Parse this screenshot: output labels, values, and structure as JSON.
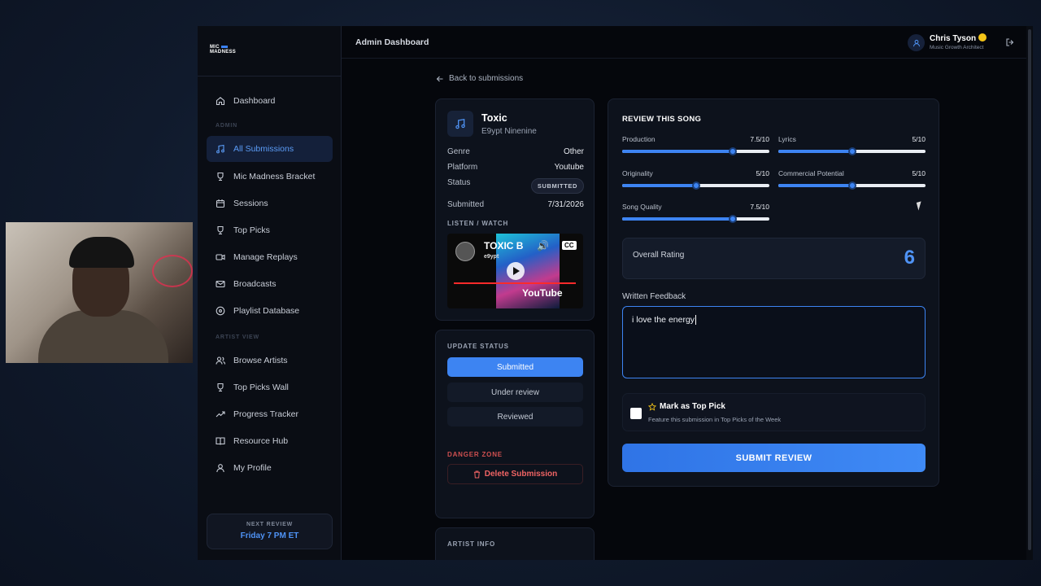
{
  "app": {
    "logo_line1": "MIC",
    "logo_line2": "MADNESS",
    "page_title": "Admin Dashboard"
  },
  "user": {
    "name": "Chris Tyson",
    "role": "Music Growth Architect"
  },
  "sidebar": {
    "items_top": [
      {
        "label": "Dashboard",
        "icon": "home-icon"
      }
    ],
    "admin_label": "ADMIN",
    "admin_items": [
      {
        "label": "All Submissions",
        "icon": "music-note-icon",
        "active": true
      },
      {
        "label": "Mic Madness Bracket",
        "icon": "trophy-icon"
      },
      {
        "label": "Sessions",
        "icon": "calendar-icon"
      },
      {
        "label": "Top Picks",
        "icon": "trophy-icon"
      },
      {
        "label": "Manage Replays",
        "icon": "video-icon"
      },
      {
        "label": "Broadcasts",
        "icon": "mail-icon"
      },
      {
        "label": "Playlist Database",
        "icon": "disc-icon"
      }
    ],
    "artist_label": "ARTIST VIEW",
    "artist_items": [
      {
        "label": "Browse Artists",
        "icon": "users-icon"
      },
      {
        "label": "Top Picks Wall",
        "icon": "trophy-icon"
      },
      {
        "label": "Progress Tracker",
        "icon": "trending-up-icon"
      },
      {
        "label": "Resource Hub",
        "icon": "book-icon"
      },
      {
        "label": "My Profile",
        "icon": "user-icon"
      }
    ],
    "next_review_label": "NEXT REVIEW",
    "next_review_value": "Friday 7 PM ET"
  },
  "back_link": "Back to submissions",
  "song": {
    "title": "Toxic",
    "artist": "E9ypt Ninenine",
    "fields": [
      {
        "label": "Genre",
        "value": "Other"
      },
      {
        "label": "Platform",
        "value": "Youtube"
      },
      {
        "label": "Status",
        "value": "SUBMITTED"
      },
      {
        "label": "Submitted",
        "value": "7/31/2026"
      }
    ],
    "listen_label": "LISTEN / WATCH",
    "video_title": "TOXIC B",
    "video_channel": "e9ypt",
    "video_brand": "YouTube",
    "video_cc": "CC"
  },
  "status_panel": {
    "label": "UPDATE STATUS",
    "options": [
      "Submitted",
      "Under review",
      "Reviewed"
    ],
    "selected": "Submitted",
    "danger_label": "DANGER ZONE",
    "delete_label": "Delete Submission"
  },
  "artist_info_label": "ARTIST INFO",
  "review": {
    "heading": "REVIEW THIS SONG",
    "criteria": [
      {
        "label": "Production",
        "value_text": "7.5/10",
        "value": 7.5,
        "max": 10
      },
      {
        "label": "Lyrics",
        "value_text": "5/10",
        "value": 5,
        "max": 10
      },
      {
        "label": "Originality",
        "value_text": "5/10",
        "value": 5,
        "max": 10
      },
      {
        "label": "Commercial Potential",
        "value_text": "5/10",
        "value": 5,
        "max": 10
      },
      {
        "label": "Song Quality",
        "value_text": "7.5/10",
        "value": 7.5,
        "max": 10
      }
    ],
    "overall_label": "Overall Rating",
    "overall_value": "6",
    "feedback_label": "Written Feedback",
    "feedback_value": "i love the energy",
    "top_pick_label": "Mark as Top Pick",
    "top_pick_desc": "Feature this submission in Top Picks of the Week",
    "top_pick_checked": false,
    "submit_label": "SUBMIT REVIEW"
  },
  "colors": {
    "accent": "#3d84f2",
    "danger": "#f06464",
    "background": "#05070c"
  }
}
